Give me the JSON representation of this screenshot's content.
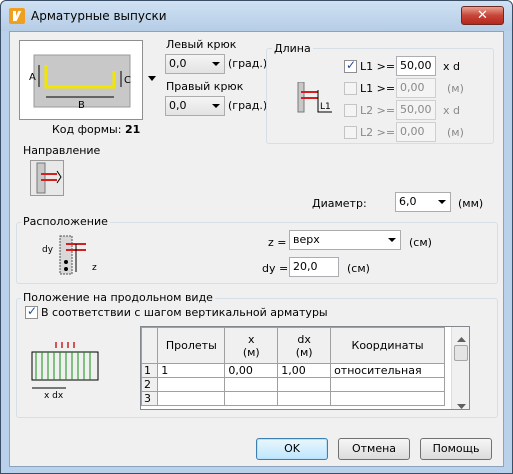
{
  "window": {
    "title": "Арматурные выпуски",
    "close_label": "✕"
  },
  "shape": {
    "code_label": "Код формы:",
    "code_value": "21",
    "dim_a": "A",
    "dim_b": "B",
    "dim_c": "C"
  },
  "hooks": {
    "left_label": "Левый крюк",
    "left_value": "0,0",
    "right_label": "Правый крюк",
    "right_value": "0,0",
    "unit": "(град.)"
  },
  "length": {
    "group_label": "Длина",
    "rows": [
      {
        "label": "L1 >=",
        "value": "50,00",
        "unit": "x d",
        "checked": true,
        "enabled": true
      },
      {
        "label": "L1 >=",
        "value": "0,00",
        "unit": "(м)",
        "checked": false,
        "enabled": false
      },
      {
        "label": "L2 >=",
        "value": "50,00",
        "unit": "x d",
        "checked": false,
        "enabled": false
      },
      {
        "label": "L2 >=",
        "value": "0,00",
        "unit": "(м)",
        "checked": false,
        "enabled": false
      }
    ],
    "icon_label": "L1"
  },
  "direction": {
    "label": "Направление"
  },
  "diameter": {
    "label": "Диаметр:",
    "value": "6,0",
    "unit": "(мм)"
  },
  "location": {
    "group_label": "Расположение",
    "z_label": "z =",
    "z_value": "верх",
    "z_unit": "(см)",
    "dy_label": "dy =",
    "dy_value": "20,0",
    "dy_unit": "(см)",
    "icon_dy": "dy",
    "icon_z": "z"
  },
  "longitudinal": {
    "group_label": "Положение на продольном виде",
    "checkbox_label": "В соответствии с шагом вертикальной арматуры",
    "checkbox_checked": true,
    "icon_label": "x  dx",
    "columns": [
      "Пролеты",
      "x\n(м)",
      "dx\n(м)",
      "Координаты"
    ],
    "rows": [
      {
        "num": "1",
        "span": "1",
        "x": "0,00",
        "dx": "1,00",
        "coords": "относительная"
      },
      {
        "num": "2",
        "span": "",
        "x": "",
        "dx": "",
        "coords": ""
      },
      {
        "num": "3",
        "span": "",
        "x": "",
        "dx": "",
        "coords": ""
      }
    ]
  },
  "buttons": {
    "ok": "OK",
    "cancel": "Отмена",
    "help": "Помощь"
  },
  "colors": {
    "shape_fill": "#c8c8c8",
    "bar": "#f2e600",
    "accent_red": "#d02020"
  }
}
